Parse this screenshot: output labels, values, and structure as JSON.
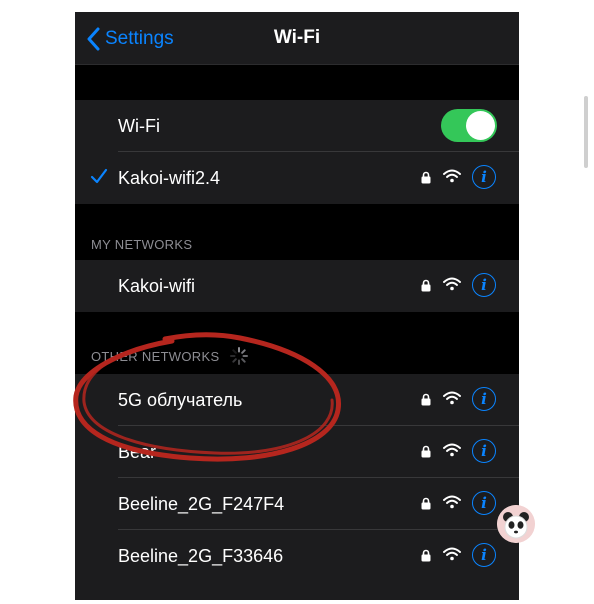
{
  "navbar": {
    "back_label": "Settings",
    "title": "Wi-Fi"
  },
  "wifi_toggle": {
    "label": "Wi-Fi",
    "enabled": true
  },
  "connected_network": {
    "name": "Kakoi-wifi2.4",
    "secured": true
  },
  "my_networks": {
    "header": "MY NETWORKS",
    "items": [
      {
        "name": "Kakoi-wifi",
        "secured": true
      }
    ]
  },
  "other_networks": {
    "header": "OTHER NETWORKS",
    "items": [
      {
        "name": "5G облучатель",
        "secured": true
      },
      {
        "name": "Bear",
        "secured": true
      },
      {
        "name": "Beeline_2G_F247F4",
        "secured": true
      },
      {
        "name": "Beeline_2G_F33646",
        "secured": true
      }
    ]
  },
  "icons": {
    "back": "chevron-left-icon",
    "check": "checkmark-icon",
    "lock": "lock-icon",
    "wifi": "wifi-signal-icon",
    "info": "info-icon",
    "loading": "spinner-icon"
  },
  "colors": {
    "accent": "#0a84ff",
    "toggle_on": "#34c759",
    "annotation": "#b5261e",
    "background": "#000000",
    "cell": "#1c1c1e"
  }
}
